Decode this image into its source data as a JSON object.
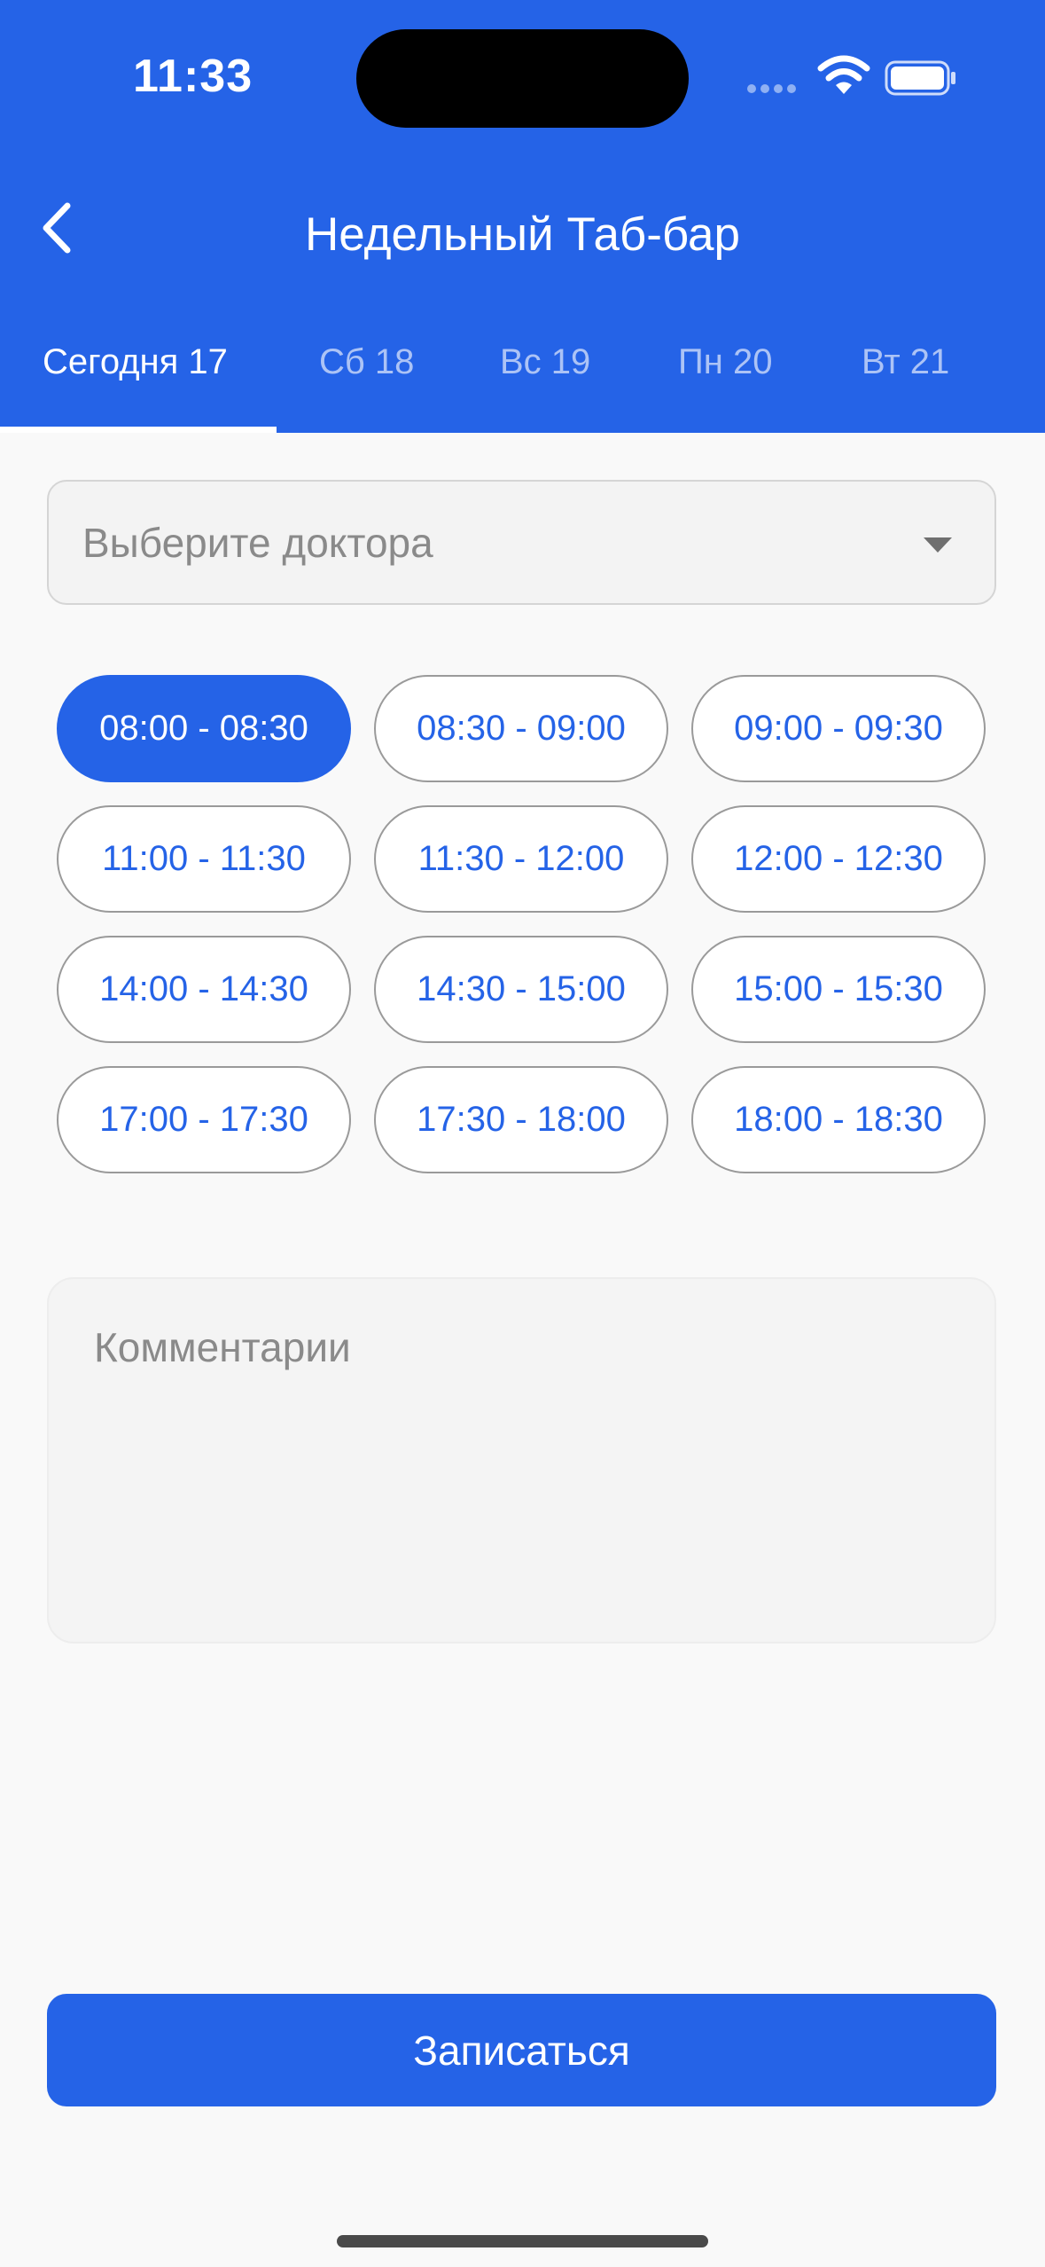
{
  "status_bar": {
    "time": "11:33"
  },
  "nav": {
    "title": "Недельный Таб-бар",
    "back_icon": "chevron-left-icon"
  },
  "tabs": [
    {
      "label": "Сегодня 17",
      "active": true
    },
    {
      "label": "Сб 18",
      "active": false
    },
    {
      "label": "Вс 19",
      "active": false
    },
    {
      "label": "Пн 20",
      "active": false
    },
    {
      "label": "Вт 21",
      "active": false
    }
  ],
  "doctor_select": {
    "placeholder": "Выберите доктора",
    "icon": "caret-down-icon"
  },
  "time_slots": [
    {
      "label": "08:00 - 08:30",
      "selected": true
    },
    {
      "label": "08:30 - 09:00",
      "selected": false
    },
    {
      "label": "09:00 - 09:30",
      "selected": false
    },
    {
      "label": "11:00 - 11:30",
      "selected": false
    },
    {
      "label": "11:30 - 12:00",
      "selected": false
    },
    {
      "label": "12:00 - 12:30",
      "selected": false
    },
    {
      "label": "14:00 - 14:30",
      "selected": false
    },
    {
      "label": "14:30 - 15:00",
      "selected": false
    },
    {
      "label": "15:00 - 15:30",
      "selected": false
    },
    {
      "label": "17:00 - 17:30",
      "selected": false
    },
    {
      "label": "17:30 - 18:00",
      "selected": false
    },
    {
      "label": "18:00 - 18:30",
      "selected": false
    }
  ],
  "comment": {
    "placeholder": "Комментарии"
  },
  "submit": {
    "label": "Записаться"
  },
  "colors": {
    "primary": "#2563e7",
    "background": "#f9f9f9"
  }
}
